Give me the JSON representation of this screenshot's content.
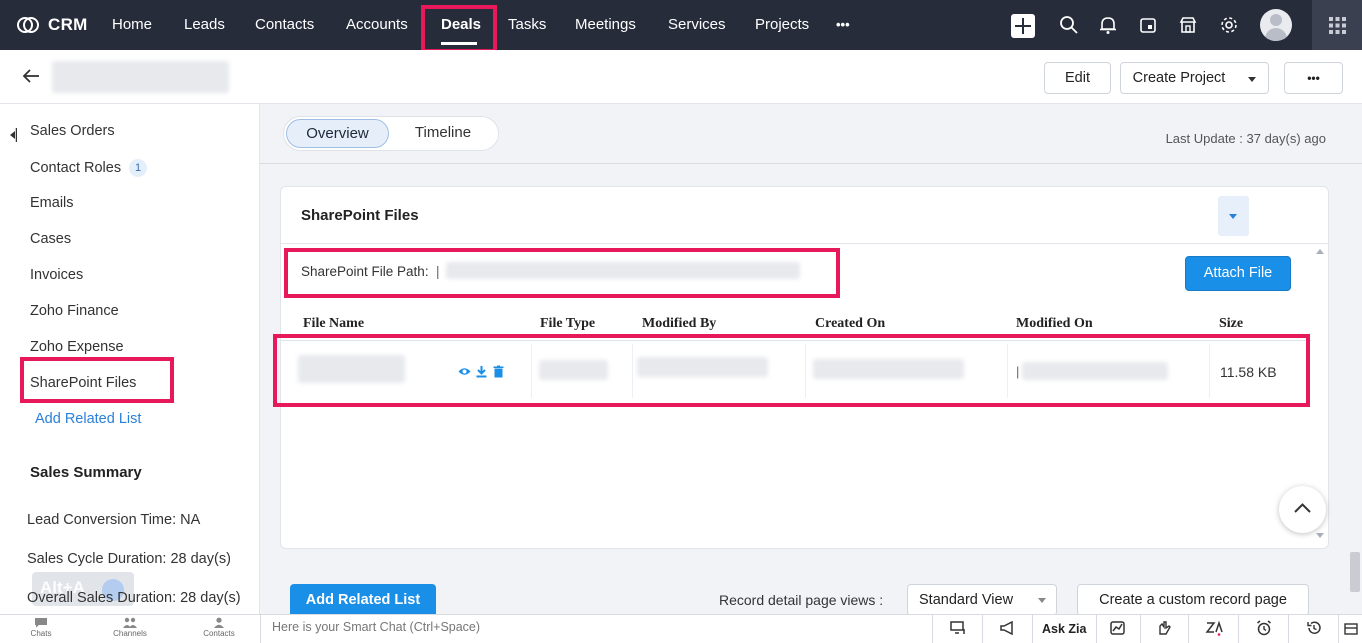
{
  "app": {
    "name": "CRM"
  },
  "nav": {
    "items": [
      "Home",
      "Leads",
      "Contacts",
      "Accounts",
      "Deals",
      "Tasks",
      "Meetings",
      "Services",
      "Projects"
    ],
    "active": "Deals",
    "more_label": "•••"
  },
  "header_icons": [
    "plus-icon",
    "search-icon",
    "bell-icon",
    "calendar-icon",
    "marketplace-icon",
    "gear-icon",
    "avatar",
    "apps-grid-icon"
  ],
  "record_actions": {
    "edit": "Edit",
    "create_project": "Create Project",
    "more": "•••"
  },
  "sidebar": {
    "items": [
      {
        "label": "Sales Orders"
      },
      {
        "label": "Contact Roles",
        "badge": "1"
      },
      {
        "label": "Emails"
      },
      {
        "label": "Cases"
      },
      {
        "label": "Invoices"
      },
      {
        "label": "Zoho Finance"
      },
      {
        "label": "Zoho Expense"
      },
      {
        "label": "SharePoint Files"
      }
    ],
    "add_related": "Add Related List",
    "summary_title": "Sales Summary",
    "stats": [
      "Lead Conversion Time: NA",
      "Sales Cycle Duration: 28 day(s)",
      "Overall Sales Duration: 28 day(s)"
    ],
    "shortcut_hint": "Alt+A"
  },
  "tabs": {
    "overview": "Overview",
    "timeline": "Timeline",
    "active": "Overview"
  },
  "last_update": "Last Update : 37 day(s) ago",
  "sharepoint": {
    "title": "SharePoint Files",
    "path_label": "SharePoint File Path: ",
    "attach_button": "Attach File",
    "columns": [
      "File Name",
      "File Type",
      "Modified By",
      "Created On",
      "Modified On",
      "Size"
    ],
    "rows": [
      {
        "size": "11.58 KB",
        "row_icons": [
          "eye-icon",
          "download-icon",
          "trash-icon"
        ]
      }
    ]
  },
  "footer": {
    "add_related_button": "Add Related List",
    "views_label": "Record detail page views :",
    "views_value": "Standard View",
    "custom_button": "Create a custom record page"
  },
  "bottombar": {
    "left": [
      "Chats",
      "Channels",
      "Contacts"
    ],
    "smart_chat_placeholder": "Here is your Smart Chat (Ctrl+Space)",
    "ask_zia": "Ask Zia"
  },
  "colors": {
    "nav_bg": "#262c3a",
    "accent": "#1a8fe8",
    "highlight": "#e8195a"
  }
}
